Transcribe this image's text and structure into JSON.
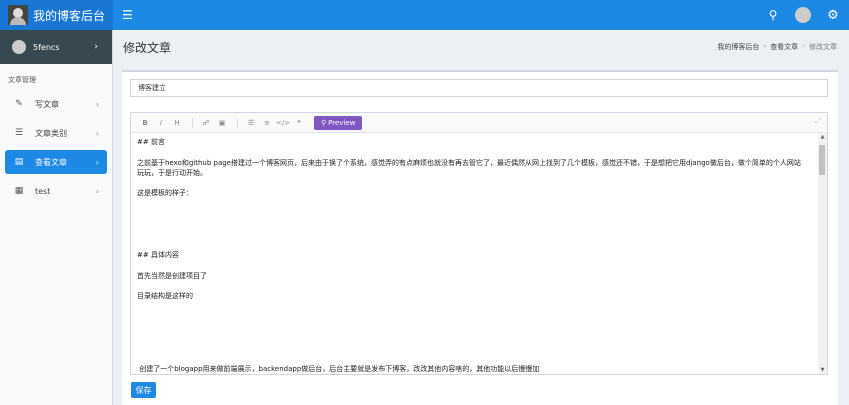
{
  "app": {
    "title": "我的博客后台"
  },
  "header": {
    "hamburger_icon": "bars-icon",
    "search_icon": "search-icon",
    "settings_icon": "gear-icon"
  },
  "user": {
    "name": "5fencs"
  },
  "sidebar": {
    "section": "文章管理",
    "items": [
      {
        "label": "写文章",
        "icon": "pencil-icon"
      },
      {
        "label": "文章类别",
        "icon": "list-icon"
      },
      {
        "label": "查看文章",
        "icon": "book-icon",
        "active": true
      },
      {
        "label": "test",
        "icon": "grid-icon"
      }
    ]
  },
  "page": {
    "title": "修改文章",
    "breadcrumb": [
      "我的博客后台",
      "查看文章",
      "修改文章"
    ]
  },
  "form": {
    "title_value": "博客建立",
    "preview_label": "Preview",
    "save_label": "保存",
    "editor_content": "## 前言\n\n之前基于hexo和github page搭建过一个博客网页，后来由于换了个系统，感觉弄的有点麻烦也就没有再去管它了，最近偶然从网上找到了几个模板，感觉还不错，于是想把它用django做后台，做个简单的个人网站玩玩，于是行动开始。\n\n这是模板的样子：\n\n\n\n\n\n## 具体内容\n\n首先当然是创建项目了\n\n目录结构是这样的\n\n\n\n\n\n\n 创建了一个blogapp用来做前端展示，backendapp做后台，后台主要就是发布下博客，改改其他内容啥的，其他功能以后慢慢加\n\n接下来就是得手脑的把模板的文件拖进来，比如静态文件拷到目录下，模板页面放到templates下，然后再把页面原本的引入的css、js链接改成自己项目下的位置。"
  }
}
